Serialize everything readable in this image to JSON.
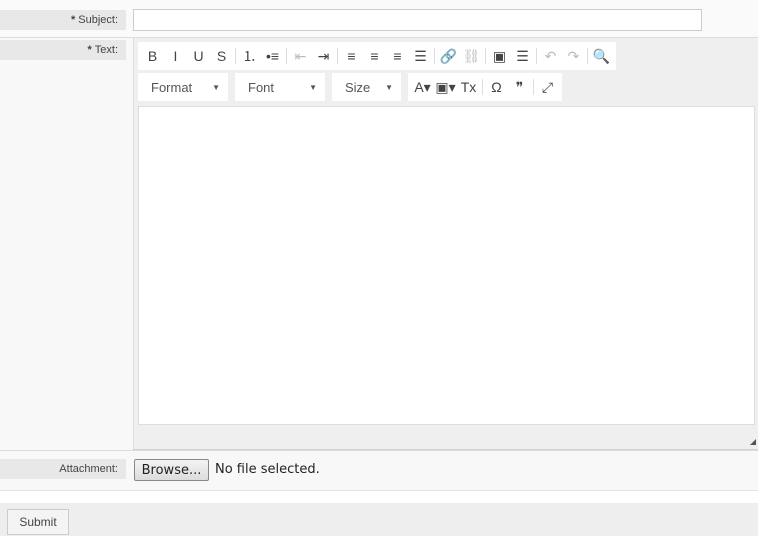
{
  "subject": {
    "label": "Subject:",
    "required_mark": "*",
    "value": "",
    "placeholder": ""
  },
  "text": {
    "label": "Text:",
    "required_mark": "*"
  },
  "toolbar": {
    "row1": [
      {
        "name": "bold-button",
        "glyph": "B",
        "disabled": false
      },
      {
        "name": "italic-button",
        "glyph": "I",
        "disabled": false
      },
      {
        "name": "underline-button",
        "glyph": "U",
        "disabled": false
      },
      {
        "name": "strikethrough-button",
        "glyph": "S",
        "disabled": false
      },
      {
        "sep": true
      },
      {
        "name": "numbered-list-button",
        "glyph": "⒈",
        "disabled": false
      },
      {
        "name": "bulleted-list-button",
        "glyph": "•≡",
        "disabled": false
      },
      {
        "sep": true
      },
      {
        "name": "outdent-button",
        "glyph": "⇤",
        "disabled": true
      },
      {
        "name": "indent-button",
        "glyph": "⇥",
        "disabled": false
      },
      {
        "sep": true
      },
      {
        "name": "align-left-button",
        "glyph": "≡",
        "disabled": false
      },
      {
        "name": "align-center-button",
        "glyph": "≡",
        "disabled": false
      },
      {
        "name": "align-right-button",
        "glyph": "≡",
        "disabled": false
      },
      {
        "name": "justify-button",
        "glyph": "☰",
        "disabled": false
      },
      {
        "sep": true
      },
      {
        "name": "link-button",
        "glyph": "🔗",
        "disabled": false
      },
      {
        "name": "unlink-button",
        "glyph": "⛓",
        "disabled": true
      },
      {
        "sep": true
      },
      {
        "name": "image-button",
        "glyph": "▣",
        "disabled": false
      },
      {
        "name": "horizontal-line-button",
        "glyph": "☰",
        "disabled": false
      },
      {
        "sep": true
      },
      {
        "name": "undo-button",
        "glyph": "↶",
        "disabled": true
      },
      {
        "name": "redo-button",
        "glyph": "↷",
        "disabled": true
      },
      {
        "sep": true
      },
      {
        "name": "find-button",
        "glyph": "🔍",
        "disabled": false
      }
    ],
    "format": "Format",
    "font": "Font",
    "size": "Size",
    "row2": [
      {
        "name": "text-color-button",
        "glyph": "A▾",
        "disabled": false
      },
      {
        "name": "background-color-button",
        "glyph": "▣▾",
        "disabled": false
      },
      {
        "name": "remove-format-button",
        "glyph": "Tx",
        "disabled": false
      },
      {
        "sep": true
      },
      {
        "name": "special-char-button",
        "glyph": "Ω",
        "disabled": false
      },
      {
        "name": "blockquote-button",
        "glyph": "❞",
        "disabled": false
      },
      {
        "sep": true
      },
      {
        "name": "maximize-button",
        "glyph": "⤢",
        "disabled": false
      }
    ]
  },
  "attachment": {
    "label": "Attachment:",
    "browse": "Browse...",
    "status": "No file selected."
  },
  "submit": "Submit"
}
